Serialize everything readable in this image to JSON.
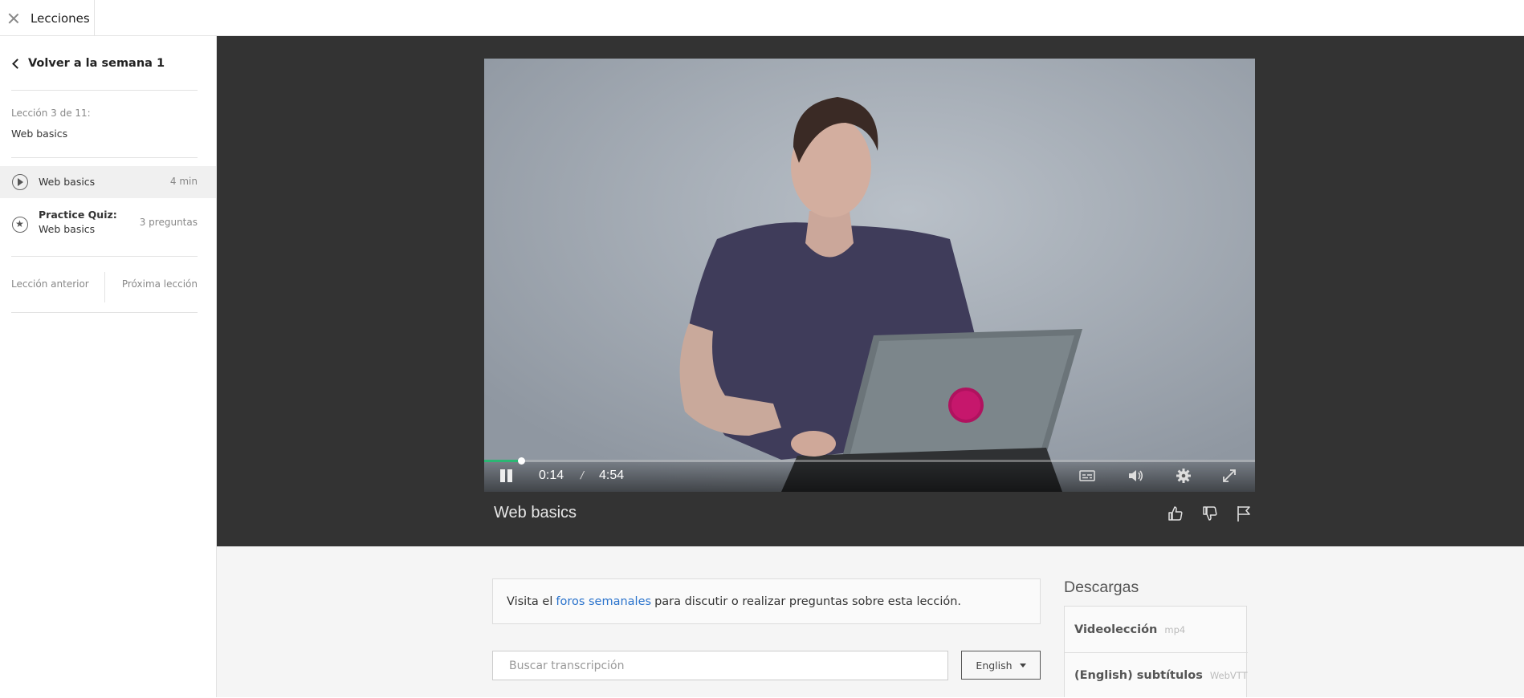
{
  "topbar": {
    "tab_label": "Lecciones"
  },
  "sidebar": {
    "back_label": "Volver a la semana 1",
    "lesson_count": "Lección 3 de 11:",
    "lesson_name": "Web basics",
    "items": [
      {
        "icon": "play-circle-icon",
        "label": "Web basics",
        "meta": "4 min",
        "active": true
      },
      {
        "icon": "star-circle-icon",
        "title": "Practice Quiz:",
        "label": "Web basics",
        "meta": "3 preguntas"
      }
    ],
    "prev_label": "Lección anterior",
    "next_label": "Próxima lección"
  },
  "player": {
    "current_time": "0:14",
    "duration": "4:54",
    "progress_fraction": 0.048,
    "accent_color": "#2bb673",
    "controls": [
      "pause-icon",
      "subtitles-icon",
      "volume-icon",
      "settings-gear-icon",
      "fullscreen-icon"
    ]
  },
  "video_title": "Web basics",
  "actions": [
    "thumbs-up-icon",
    "thumbs-down-icon",
    "flag-icon"
  ],
  "forum": {
    "prefix": "Visita el",
    "link": "foros semanales",
    "suffix": "para discutir o realizar preguntas sobre esta lección."
  },
  "transcript": {
    "search_placeholder": "Buscar transcripción",
    "language": "English"
  },
  "downloads": {
    "title": "Descargas",
    "items": [
      {
        "label": "Videolección",
        "ext": "mp4"
      },
      {
        "label": "(English) subtítulos",
        "ext": "WebVTT"
      }
    ]
  }
}
